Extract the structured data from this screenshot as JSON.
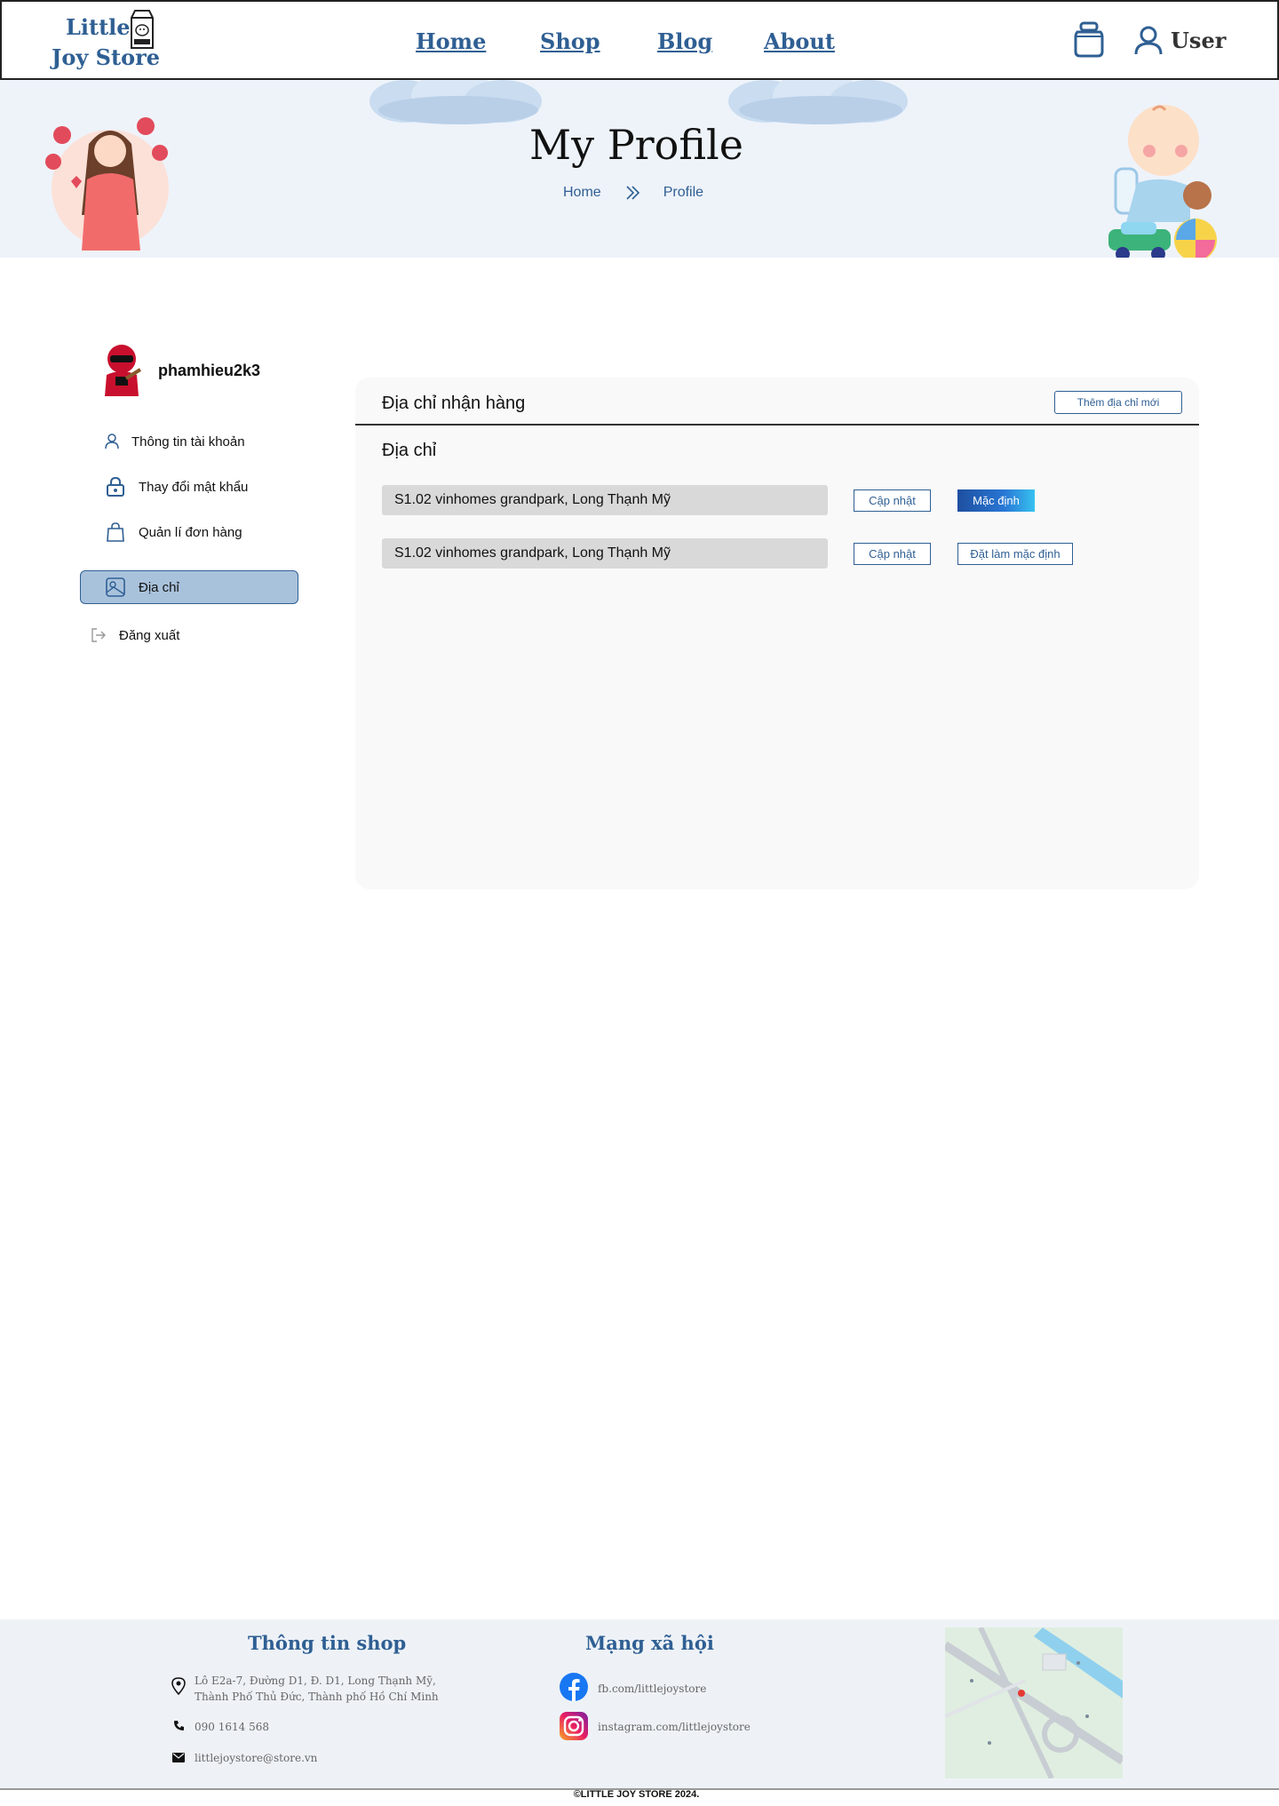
{
  "header": {
    "logo_line1": "Little",
    "logo_line2": "Joy Store",
    "nav": [
      "Home",
      "Shop",
      "Blog",
      "About"
    ],
    "user_label": "User"
  },
  "banner": {
    "title": "My Profile",
    "breadcrumb": [
      "Home",
      "Profile"
    ]
  },
  "sidebar": {
    "username": "phamhieu2k3",
    "items": [
      {
        "label": "Thông tin tài khoản",
        "icon": "user-icon"
      },
      {
        "label": "Thay đổi mật khẩu",
        "icon": "lock-icon"
      },
      {
        "label": "Quản lí đơn hàng",
        "icon": "shopping-bag-icon"
      },
      {
        "label": "Địa chỉ",
        "icon": "map-icon",
        "active": true
      },
      {
        "label": "Đăng xuất",
        "icon": "logout-icon"
      }
    ]
  },
  "main": {
    "card_title": "Địa chỉ nhận hàng",
    "add_button": "Thêm địa chỉ mới",
    "section_title": "Địa chỉ",
    "addresses": [
      {
        "value": "S1.02 vinhomes grandpark, Long Thạnh Mỹ",
        "update_label": "Cập nhật",
        "default_label": "Mặc định",
        "is_default": true
      },
      {
        "value": "S1.02 vinhomes grandpark, Long Thạnh Mỹ",
        "update_label": "Cập nhật",
        "default_label": "Đặt làm mặc định",
        "is_default": false
      }
    ]
  },
  "footer": {
    "shop_info_title": "Thông tin shop",
    "address_line1": "Lô E2a-7, Đường D1, Đ. D1, Long Thạnh Mỹ,",
    "address_line2": "Thành Phố Thủ Đức, Thành phố Hồ Chí Minh",
    "phone": "090 1614 568",
    "email": "littlejoystore@store.vn",
    "social_title": "Mạng xã hội",
    "facebook": "fb.com/littlejoystore",
    "instagram": "instagram.com/littlejoystore",
    "copyright": "©LITTLE JOY STORE 2024."
  },
  "colors": {
    "brand": "#2f5f93",
    "active_item_bg": "#a9c2dc",
    "banner_bg": "#eef3fa",
    "footer_bg": "#eef2f7",
    "default_gradient_start": "#1e4fa0",
    "default_gradient_end": "#37c1f0"
  }
}
